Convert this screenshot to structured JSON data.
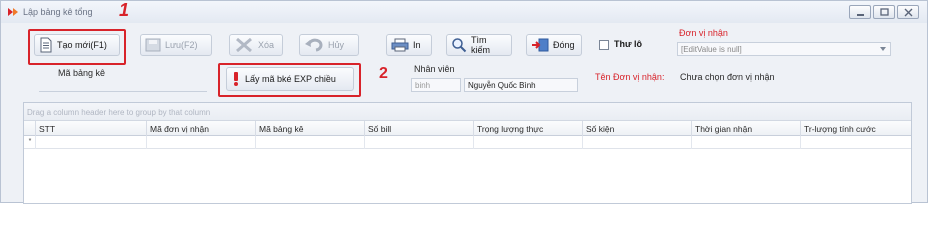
{
  "window": {
    "title": "Lập bảng kê tổng"
  },
  "annotations": {
    "mark_1": "1",
    "mark_2": "2"
  },
  "toolbar": {
    "new_label": "Tạo mới(F1)",
    "save_label": "Lưu(F2)",
    "delete_label": "Xóa",
    "cancel_label": "Hủy",
    "print_label": "In",
    "search_label": "Tìm kiếm",
    "close_label": "Đóng",
    "letter_label": "Thư lô"
  },
  "form": {
    "receiver_unit_label": "Đơn vị nhận",
    "receiver_unit_value": "[EditValue is null]",
    "list_code_label": "Mã bảng kê",
    "list_code_value": "",
    "fetch_button_label": "Lấy mã bké EXP chiều",
    "employee_label": "Nhân viên",
    "employee_code": "binh",
    "employee_name": "Nguyễn Quốc Bình",
    "receiver_name_label": "Tên Đơn vị nhận:",
    "receiver_name_value": "Chưa chọn đơn vị nhận"
  },
  "grid": {
    "group_hint": "Drag a column header here to group by that column",
    "columns": [
      "STT",
      "Mã đơn vị nhận",
      "Mã bảng kê",
      "Số bill",
      "Trọng lượng thực",
      "Số kiện",
      "Thời gian nhận",
      "Tr-lượng tính cước"
    ],
    "new_row_indicator": "*"
  },
  "colors": {
    "annotation_red": "#d8232a",
    "accent_red": "#d8232a"
  }
}
